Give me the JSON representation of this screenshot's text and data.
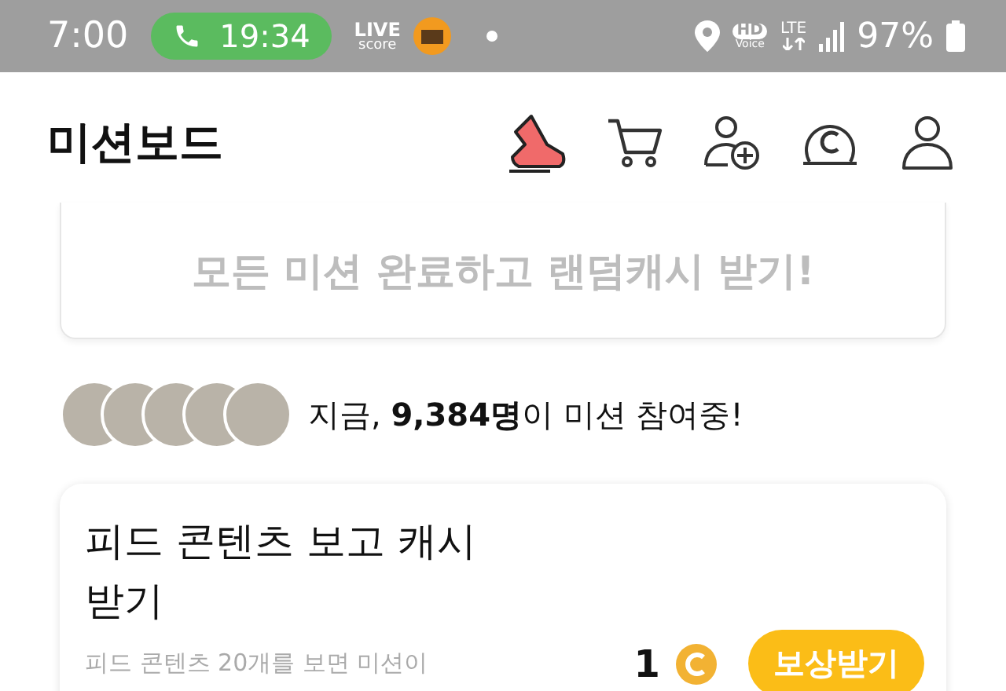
{
  "status_bar": {
    "time": "7:00",
    "call_timer": "19:34",
    "live_top": "LIVE",
    "live_bottom": "score",
    "hd": "HD",
    "voice": "Voice",
    "network": "LTE",
    "battery": "97%"
  },
  "header": {
    "title": "미션보드"
  },
  "banner": {
    "text": "모든 미션 완료하고 랜덤캐시 받기!"
  },
  "participants": {
    "text": "지금, **9,384명**이 미션 참여중!"
  },
  "missions": [
    {
      "title": "피드 콘텐츠 보고 캐시 받기",
      "description": "피드 콘텐츠 20개를 보면 미션이",
      "reward": "1",
      "button": "보상받기"
    }
  ]
}
